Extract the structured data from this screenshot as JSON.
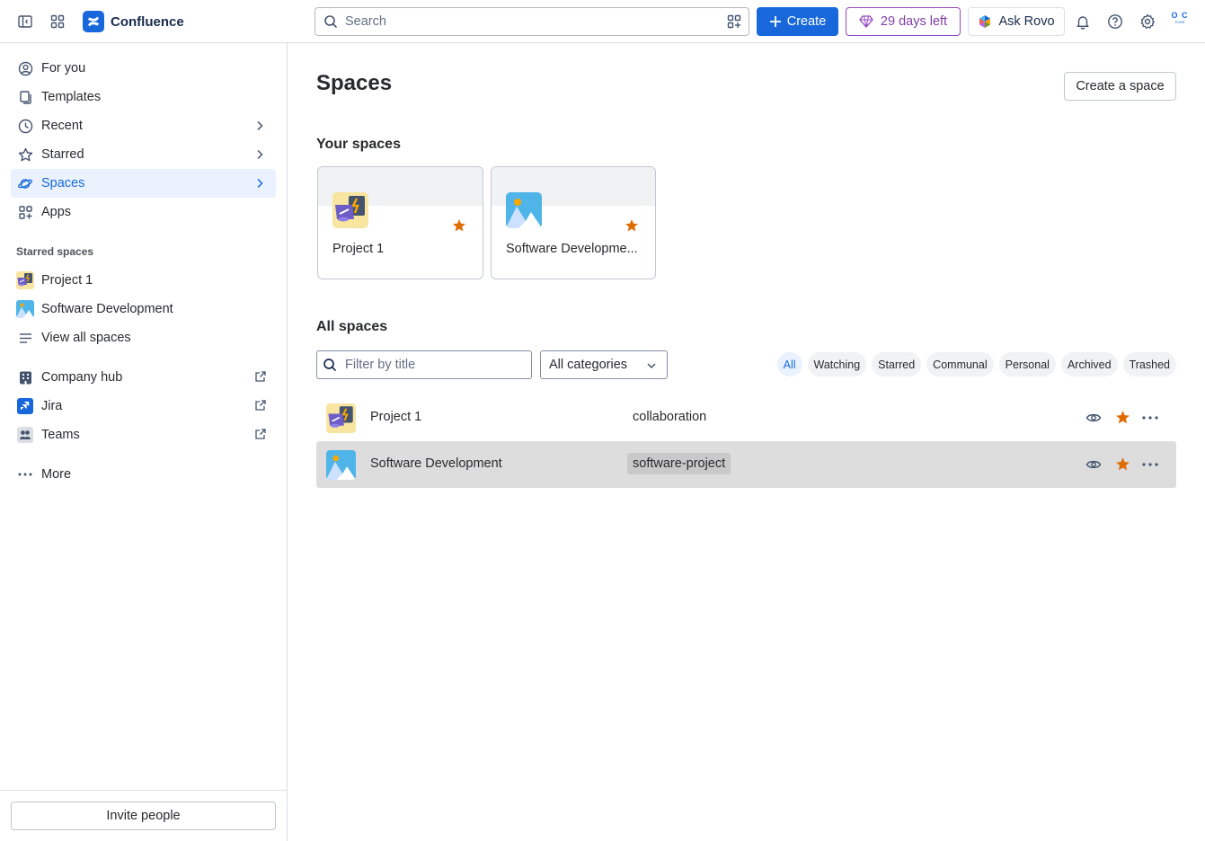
{
  "app": {
    "name": "Confluence",
    "search_placeholder": "Search",
    "create_label": "Create",
    "trial_label": "29 days left",
    "rovo_label": "Ask Rovo",
    "avatar_initials": "O C",
    "avatar_sub": "PURE",
    "accent": "#1868db"
  },
  "sidebar": {
    "nav": [
      {
        "label": "For you",
        "icon": "person-circle-icon"
      },
      {
        "label": "Templates",
        "icon": "template-icon"
      },
      {
        "label": "Recent",
        "icon": "clock-icon"
      },
      {
        "label": "Starred",
        "icon": "star-outline-icon"
      },
      {
        "label": "Spaces",
        "icon": "planet-icon"
      },
      {
        "label": "Apps",
        "icon": "apps-icon"
      }
    ],
    "starred_heading": "Starred spaces",
    "starred": [
      {
        "label": "Project 1"
      },
      {
        "label": "Software Development"
      }
    ],
    "view_all": "View all spaces",
    "links": [
      {
        "label": "Company hub"
      },
      {
        "label": "Jira"
      },
      {
        "label": "Teams"
      }
    ],
    "more": "More",
    "invite": "Invite people"
  },
  "main": {
    "title": "Spaces",
    "create_space": "Create a space",
    "your_spaces_heading": "Your spaces",
    "your_spaces": [
      {
        "name": "Project 1"
      },
      {
        "name": "Software Developme..."
      }
    ],
    "all_spaces_heading": "All spaces",
    "filter_placeholder": "Filter by title",
    "category_select": "All categories",
    "chips": [
      "All",
      "Watching",
      "Starred",
      "Communal",
      "Personal",
      "Archived",
      "Trashed"
    ],
    "rows": [
      {
        "name": "Project 1",
        "category": "collaboration"
      },
      {
        "name": "Software Development",
        "category": "software-project"
      }
    ],
    "star_color": "#e06c00"
  }
}
